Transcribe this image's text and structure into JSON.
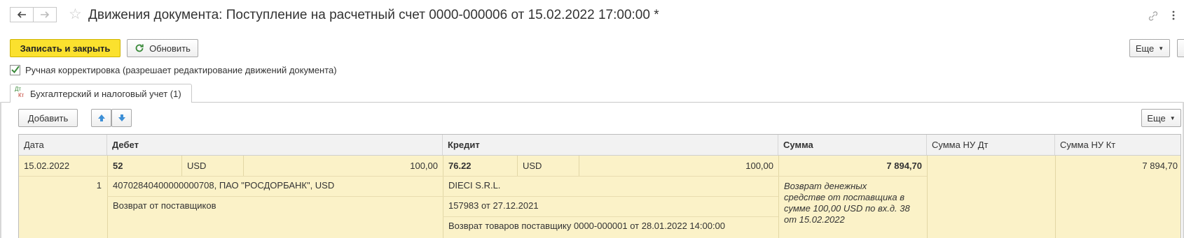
{
  "window": {
    "title": "Движения документа: Поступление на расчетный счет 0000-000006 от 15.02.2022 17:00:00 *"
  },
  "toolbar": {
    "save_close_label": "Записать и закрыть",
    "refresh_label": "Обновить",
    "more_label": "Еще"
  },
  "manual_correction": {
    "label": "Ручная корректировка (разрешает редактирование движений документа)",
    "checked": true
  },
  "tabs": [
    {
      "label": "Бухгалтерский и налоговый учет (1)",
      "icon_text_top": "Дт",
      "icon_text_bottom": "Кт"
    }
  ],
  "table_toolbar": {
    "add_label": "Добавить",
    "more_label": "Еще"
  },
  "table": {
    "columns": [
      "Дата",
      "Дебет",
      "Кредит",
      "Сумма",
      "Сумма НУ Дт",
      "Сумма НУ Кт"
    ],
    "rows": [
      {
        "date": "15.02.2022",
        "line_no": "1",
        "debit_account": "52",
        "debit_currency": "USD",
        "debit_amount": "100,00",
        "debit_subconto1": "40702840400000000708, ПАО \"РОСДОРБАНК\", USD",
        "debit_subconto2": "Возврат от поставщиков",
        "credit_account": "76.22",
        "credit_currency": "USD",
        "credit_amount": "100,00",
        "credit_subconto1": "DIECI S.R.L.",
        "credit_subconto2": "157983 от 27.12.2021",
        "credit_subconto3": "Возврат товаров поставщику 0000-000001 от 28.01.2022 14:00:00",
        "sum": "7 894,70",
        "sum_comment": "Возврат денежных средстве от поставщика в сумме 100,00 USD по вх.д. 38 от 15.02.2022",
        "sum_nu_dt": "",
        "sum_nu_kt": "7 894,70"
      }
    ]
  },
  "colors": {
    "accent": "#fbe12e",
    "row_selected": "#fbf2c8",
    "arrow_blue": "#3d8fd6",
    "check_green": "#3a8a3a"
  }
}
